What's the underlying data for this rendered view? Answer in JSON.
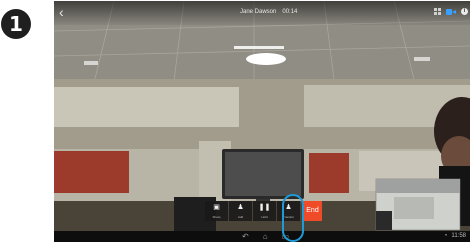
{
  "step": {
    "number": "1"
  },
  "call": {
    "contact_name": "Jane Dawson",
    "duration": "00:14"
  },
  "toolbar": {
    "buttons": [
      {
        "label": "Share",
        "icon": "share-icon"
      },
      {
        "label": "Add",
        "icon": "add-participant-icon"
      },
      {
        "label": "Hold",
        "icon": "pause-icon"
      },
      {
        "label": "Transfer",
        "icon": "transfer-icon"
      }
    ],
    "end_label": "End"
  },
  "status_bar": {
    "time": "11:58",
    "left_text": "",
    "nav_icons": [
      "back-icon",
      "home-icon",
      "recent-apps-icon"
    ]
  },
  "colors": {
    "accent": "#3aa0ff",
    "end_button": "#ef4b29",
    "highlight": "#1e9bd7"
  }
}
